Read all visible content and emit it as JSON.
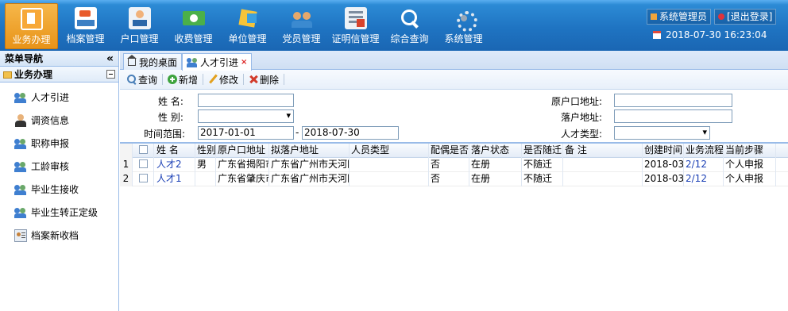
{
  "topnav": {
    "items": [
      {
        "label": "业务办理",
        "icon": "briefcase-icon",
        "active": true
      },
      {
        "label": "档案管理",
        "icon": "archive-icon"
      },
      {
        "label": "户口管理",
        "icon": "household-icon"
      },
      {
        "label": "收费管理",
        "icon": "money-icon"
      },
      {
        "label": "单位管理",
        "icon": "company-icon"
      },
      {
        "label": "党员管理",
        "icon": "party-members-icon"
      },
      {
        "label": "证明信管理",
        "icon": "certificate-icon"
      },
      {
        "label": "综合查询",
        "icon": "search-icon"
      },
      {
        "label": "系统管理",
        "icon": "settings-icon"
      }
    ]
  },
  "user": {
    "name": "系统管理员",
    "logout": "[退出登录]",
    "datetime": "2018-07-30 16:23:04"
  },
  "sidebar": {
    "title": "菜单导航",
    "collapse": "«",
    "group": "业务办理",
    "items": [
      {
        "label": "人才引进",
        "icon": "people-icon"
      },
      {
        "label": "调资信息",
        "icon": "manager-icon"
      },
      {
        "label": "职称申报",
        "icon": "people-icon"
      },
      {
        "label": "工龄审核",
        "icon": "people-icon"
      },
      {
        "label": "毕业生接收",
        "icon": "people-icon"
      },
      {
        "label": "毕业生转正定级",
        "icon": "people-icon"
      },
      {
        "label": "档案新收档",
        "icon": "archive-card-icon"
      }
    ]
  },
  "tabs": [
    {
      "label": "我的桌面"
    },
    {
      "label": "人才引进",
      "close": "×"
    }
  ],
  "toolbar": {
    "query": "查询",
    "add": "新增",
    "edit": "修改",
    "delete": "删除"
  },
  "form": {
    "name_label": "姓 名:",
    "name_value": "",
    "gender_label": "性 别:",
    "gender_value": "",
    "range_label": "时间范围:",
    "date_from": "2017-01-01",
    "date_sep": "-",
    "date_to": "2018-07-30",
    "orig_address_label": "原户口地址:",
    "orig_address_value": "",
    "new_address_label": "落户地址:",
    "new_address_value": "",
    "talent_type_label": "人才类型:",
    "talent_type_value": ""
  },
  "grid": {
    "columns": [
      "姓 名",
      "性别",
      "原户口地址",
      "拟落户地址",
      "人员类型",
      "配偶是否",
      "落户状态",
      "是否随迁",
      "备 注",
      "创建时间",
      "业务流程",
      "当前步骤"
    ],
    "rows": [
      {
        "num": "1",
        "name": "人才2",
        "gender": "男",
        "orig": "广东省揭阳市",
        "target": "广东省广州市天河区",
        "type": "",
        "spouse": "否",
        "status": "在册",
        "follow": "不随迁",
        "note": "",
        "created": "2018-03-",
        "flow": "2/12",
        "step": "个人申报"
      },
      {
        "num": "2",
        "name": "人才1",
        "gender": "",
        "orig": "广东省肇庆市",
        "target": "广东省广州市天河区",
        "type": "",
        "spouse": "否",
        "status": "在册",
        "follow": "不随迁",
        "note": "",
        "created": "2018-03-",
        "flow": "2/12",
        "step": "个人申报"
      }
    ]
  }
}
